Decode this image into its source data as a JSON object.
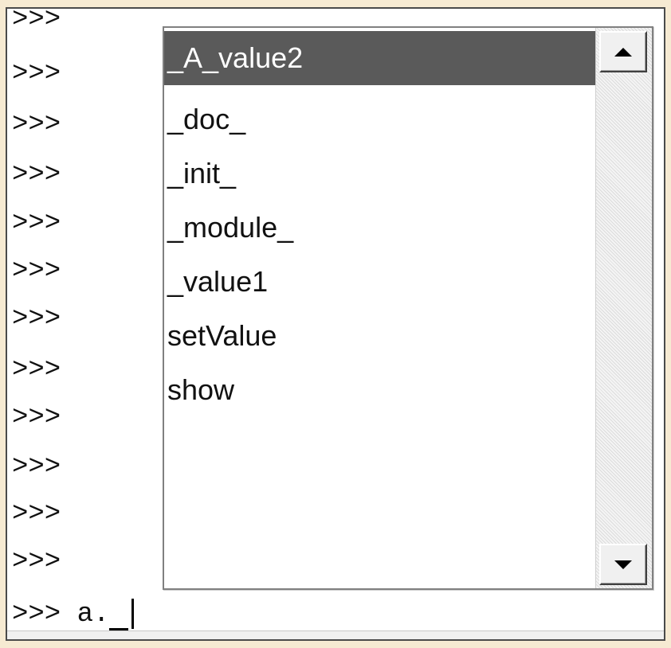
{
  "shell": {
    "prompts": [
      ">>>",
      ">>>",
      ">>>",
      ">>>",
      ">>>",
      ">>>",
      ">>>",
      ">>>",
      ">>>",
      ">>>",
      ">>>",
      ">>>"
    ],
    "current_prompt": ">>>",
    "current_input": "a."
  },
  "autocomplete": {
    "selected_index": 0,
    "items": [
      "_A_value2",
      "_doc_",
      "_init_",
      "_module_",
      "_value1",
      "setValue",
      "show"
    ],
    "scroll_up_icon": "triangle-up-icon",
    "scroll_down_icon": "triangle-down-icon"
  },
  "colors": {
    "background": "#f6ead2",
    "selection": "#5a5a5a",
    "selection_text": "#ffffff"
  }
}
